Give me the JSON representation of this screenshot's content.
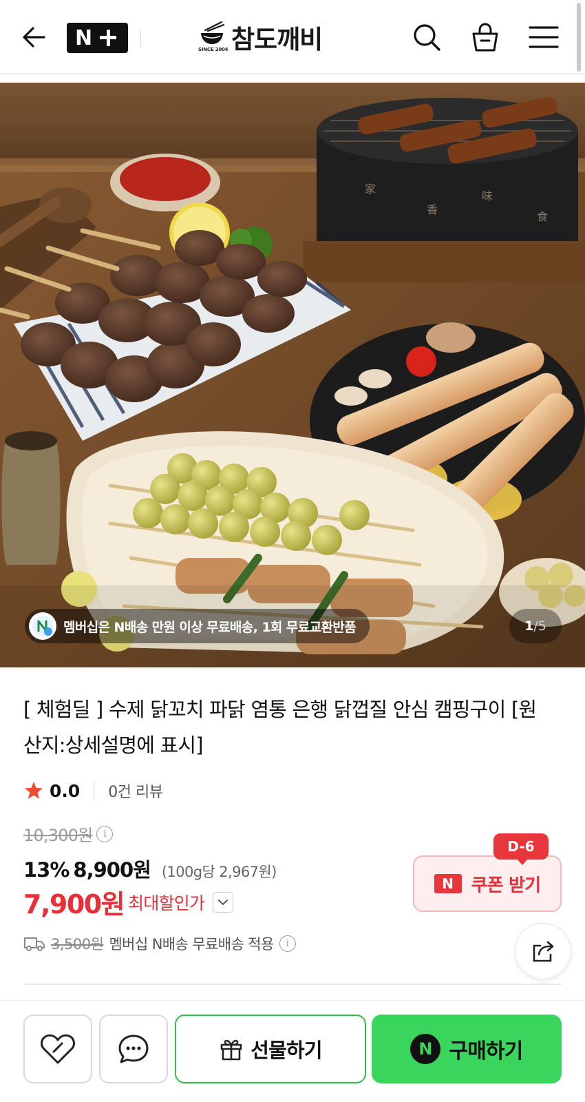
{
  "header": {
    "back_icon": "arrow-left-icon",
    "badge_n": "N",
    "brand_name": "참도깨비",
    "brand_since": "SINCE 2004",
    "icons": [
      "search-icon",
      "cart-icon",
      "menu-icon"
    ]
  },
  "hero": {
    "promo_text": "멤버십은 N배송 만원 이상 무료배송, 1회 무료교환반품",
    "pager_current": "1",
    "pager_sep": "/",
    "pager_total": "5"
  },
  "product": {
    "title": "[ 체험딜 ] 수제 닭꼬치 파닭 염통 은행 닭껍질 안심 캠핑구이 [원산지:상세설명에 표시]",
    "rating_value": "0.0",
    "review_count": "0건 리뷰",
    "original_price": "10,300원",
    "sale_rate": "13%",
    "sale_price": "8,900원",
    "unit_price": "(100g당 2,967원)",
    "max_discount_price": "7,900원",
    "max_discount_label": "최대할인가",
    "coupon_dday": "D-6",
    "coupon_n": "N",
    "coupon_label": "쿠폰 받기",
    "shipping_original": "3,500원",
    "shipping_text": "멤버십 N배송 무료배송 적용"
  },
  "bottom": {
    "gift_label": "선물하기",
    "buy_n": "N",
    "buy_label": "구매하기"
  },
  "colors": {
    "accent_red": "#e62f37",
    "accent_green": "#3ad55c",
    "gift_border": "#2dbe4a"
  }
}
